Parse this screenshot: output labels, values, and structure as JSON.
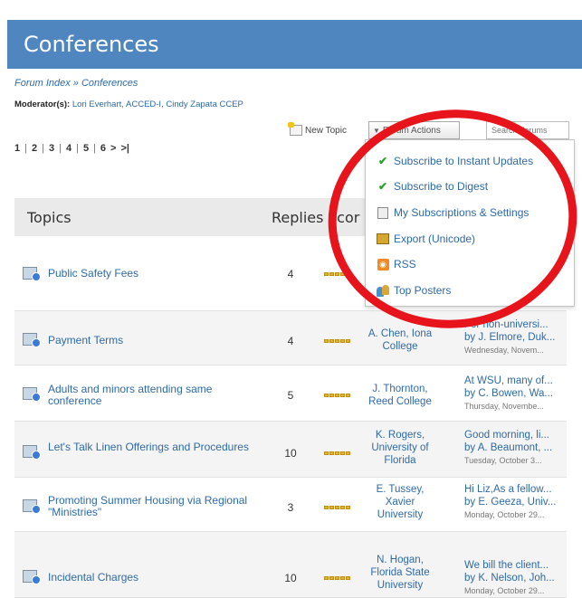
{
  "header": {
    "title": "Conferences"
  },
  "breadcrumb": "Forum Index » Conferences",
  "moderators": {
    "label": "Moderator(s):",
    "names": "Lori Everhart, ACCED-I, Cindy Zapata CCEP"
  },
  "toolbar": {
    "new_topic_label": "New Topic",
    "forum_actions_label": "Forum Actions",
    "search_placeholder": "Search Forums"
  },
  "pagination": {
    "pages": [
      "1",
      "2",
      "3",
      "4",
      "5",
      "6"
    ],
    "next": ">",
    "last": ">|"
  },
  "forum_actions_menu": {
    "items": [
      {
        "label": "Subscribe to Instant Updates",
        "icon": "check-icon"
      },
      {
        "label": "Subscribe to Digest",
        "icon": "check-icon"
      },
      {
        "label": "My Subscriptions & Settings",
        "icon": "settings-icon"
      },
      {
        "label": "Export (Unicode)",
        "icon": "export-icon"
      },
      {
        "label": "RSS",
        "icon": "rss-icon"
      },
      {
        "label": "Top Posters",
        "icon": "top-posters-icon"
      }
    ]
  },
  "table": {
    "headers": {
      "topics": "Topics",
      "replies": "Replies",
      "score": "Scor"
    },
    "rows": [
      {
        "topic": "Public Safety Fees",
        "replies": "4",
        "author": "",
        "last_post": "",
        "last_by": "",
        "last_date": ""
      },
      {
        "topic": "Payment Terms",
        "replies": "4",
        "author": "A. Chen, Iona College",
        "last_post": "For non-universi...",
        "last_by": "by J. Elmore, Duk...",
        "last_date": "Wednesday, Novem..."
      },
      {
        "topic": "Adults and minors attending same conference",
        "replies": "5",
        "author": "J. Thornton, Reed College",
        "last_post": "At WSU, many of...",
        "last_by": "by C. Bowen, Wa...",
        "last_date": "Thursday, Novembe..."
      },
      {
        "topic": "Let's Talk Linen Offerings and Procedures",
        "replies": "10",
        "author": "K. Rogers, University of Florida",
        "last_post": "Good morning, li...",
        "last_by": "by A. Beaumont, ...",
        "last_date": "Tuesday, October 3..."
      },
      {
        "topic": "Promoting Summer Housing via Regional \"Ministries\"",
        "replies": "3",
        "author": "E. Tussey, Xavier University",
        "last_post": "Hi Liz,As a fellow...",
        "last_by": "by E. Geeza, Univ...",
        "last_date": "Monday, October 29..."
      },
      {
        "topic": "Incidental Charges",
        "replies": "10",
        "author": "N. Hogan, Florida State University",
        "last_post": "We bill the client...",
        "last_by": "by K. Nelson, Joh...",
        "last_date": "Monday, October 29..."
      }
    ]
  },
  "colors": {
    "header_bg": "#4f86c0",
    "link": "#2e6aa6",
    "annotation": "#e8141b"
  }
}
